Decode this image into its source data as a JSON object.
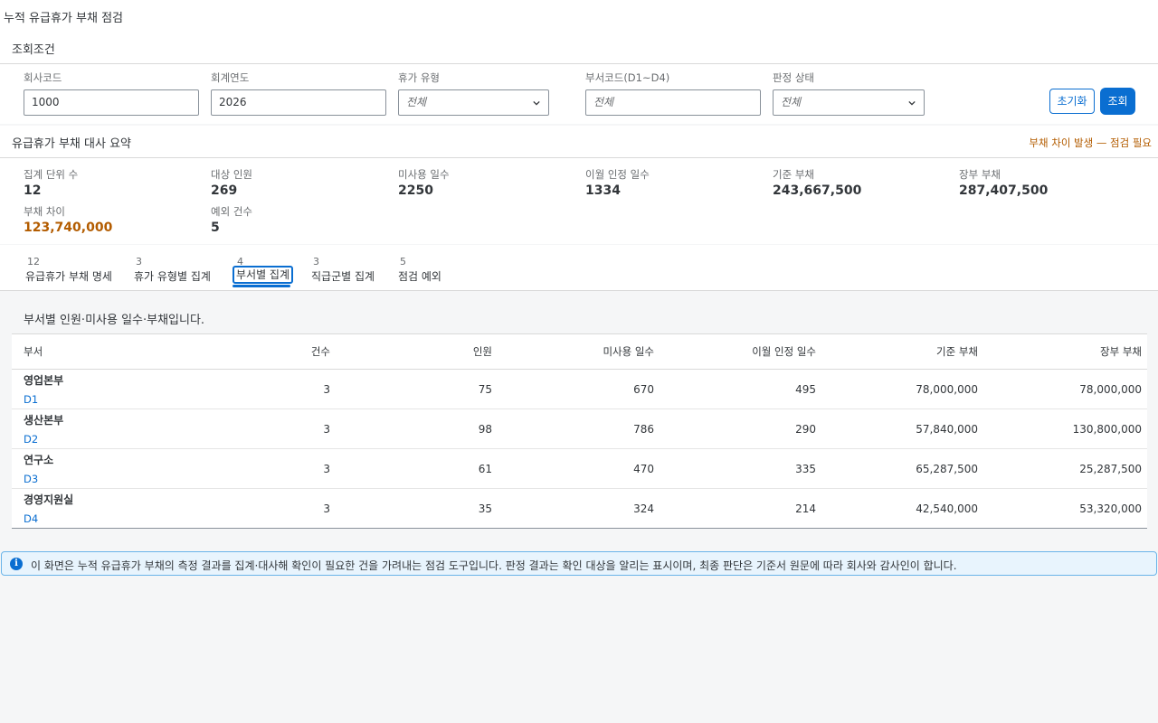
{
  "app": {
    "title": "누적 유급휴가 부채 점검"
  },
  "filters": {
    "section_title": "조회조건",
    "company_code": {
      "label": "회사코드",
      "value": "1000"
    },
    "fiscal_year": {
      "label": "회계연도",
      "value": "2026"
    },
    "leave_type": {
      "label": "휴가 유형",
      "value": "전체"
    },
    "dept_code": {
      "label": "부서코드(D1~D4)",
      "placeholder": "전체"
    },
    "judgment_status": {
      "label": "판정 상태",
      "value": "전체"
    },
    "reset_label": "초기화",
    "search_label": "조회"
  },
  "summary": {
    "section_title": "유급휴가 부채 대사 요약",
    "warning": "부채 차이 발생 — 점검 필요",
    "kpis": [
      {
        "label": "집계 단위 수",
        "value": "12"
      },
      {
        "label": "대상 인원",
        "value": "269"
      },
      {
        "label": "미사용 일수",
        "value": "2250"
      },
      {
        "label": "이월 인정 일수",
        "value": "1334"
      },
      {
        "label": "기준 부채",
        "value": "243,667,500"
      },
      {
        "label": "장부 부채",
        "value": "287,407,500"
      },
      {
        "label": "부채 차이",
        "value": "123,740,000"
      },
      {
        "label": "예외 건수",
        "value": "5"
      }
    ]
  },
  "tabs": [
    {
      "count": "12",
      "label": "유급휴가 부채 명세"
    },
    {
      "count": "3",
      "label": "휴가 유형별 집계"
    },
    {
      "count": "4",
      "label": "부서별 집계"
    },
    {
      "count": "3",
      "label": "직급군별 집계"
    },
    {
      "count": "5",
      "label": "점검 예외"
    }
  ],
  "dept_table": {
    "description": "부서별 인원·미사용 일수·부채입니다.",
    "columns": [
      "부서",
      "건수",
      "인원",
      "미사용 일수",
      "이월 인정 일수",
      "기준 부채",
      "장부 부채"
    ],
    "rows": [
      {
        "name": "영업본부",
        "code": "D1",
        "cases": "3",
        "headcount": "75",
        "unused_days": "670",
        "carryover_days": "495",
        "base_liability": "78,000,000",
        "book_liability": "78,000,000"
      },
      {
        "name": "생산본부",
        "code": "D2",
        "cases": "3",
        "headcount": "98",
        "unused_days": "786",
        "carryover_days": "290",
        "base_liability": "57,840,000",
        "book_liability": "130,800,000"
      },
      {
        "name": "연구소",
        "code": "D3",
        "cases": "3",
        "headcount": "61",
        "unused_days": "470",
        "carryover_days": "335",
        "base_liability": "65,287,500",
        "book_liability": "25,287,500"
      },
      {
        "name": "경영지원실",
        "code": "D4",
        "cases": "3",
        "headcount": "35",
        "unused_days": "324",
        "carryover_days": "214",
        "base_liability": "42,540,000",
        "book_liability": "53,320,000"
      }
    ]
  },
  "notice": {
    "text": "이 화면은 누적 유급휴가 부채의 측정 결과를 집계·대사해 확인이 필요한 건을 가려내는 점검 도구입니다. 판정 결과는 확인 대상을 알리는 표시이며, 최종 판단은 기준서 원문에 따라 회사와 감사인이 합니다."
  }
}
